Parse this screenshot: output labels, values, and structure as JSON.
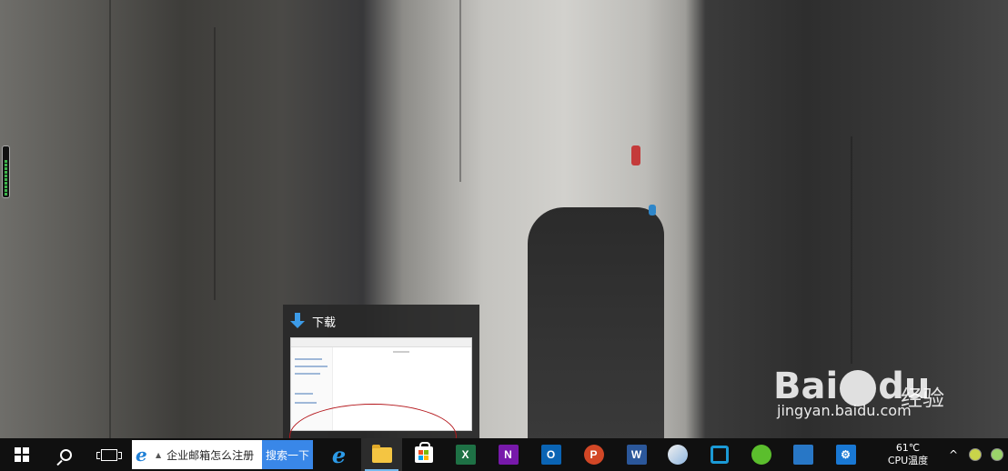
{
  "desktop": {
    "watermark_logo": "Bai du",
    "watermark_sub": "经验",
    "watermark_url": "jingyan.baidu.com"
  },
  "thumbnail": {
    "title": "下载"
  },
  "taskbar": {
    "search_placeholder": "企业邮箱怎么注册",
    "search_button": "搜索一下",
    "apps": [
      {
        "name": "edge",
        "label": "e"
      },
      {
        "name": "file-explorer",
        "label": ""
      },
      {
        "name": "store",
        "label": ""
      },
      {
        "name": "excel",
        "label": "X"
      },
      {
        "name": "onenote",
        "label": "N"
      },
      {
        "name": "outlook",
        "label": "O"
      },
      {
        "name": "powerpoint",
        "label": "P"
      },
      {
        "name": "word",
        "label": "W"
      }
    ],
    "tray": {
      "temp": "61℃",
      "temp_label": "CPU温度",
      "chevron": "^"
    }
  }
}
